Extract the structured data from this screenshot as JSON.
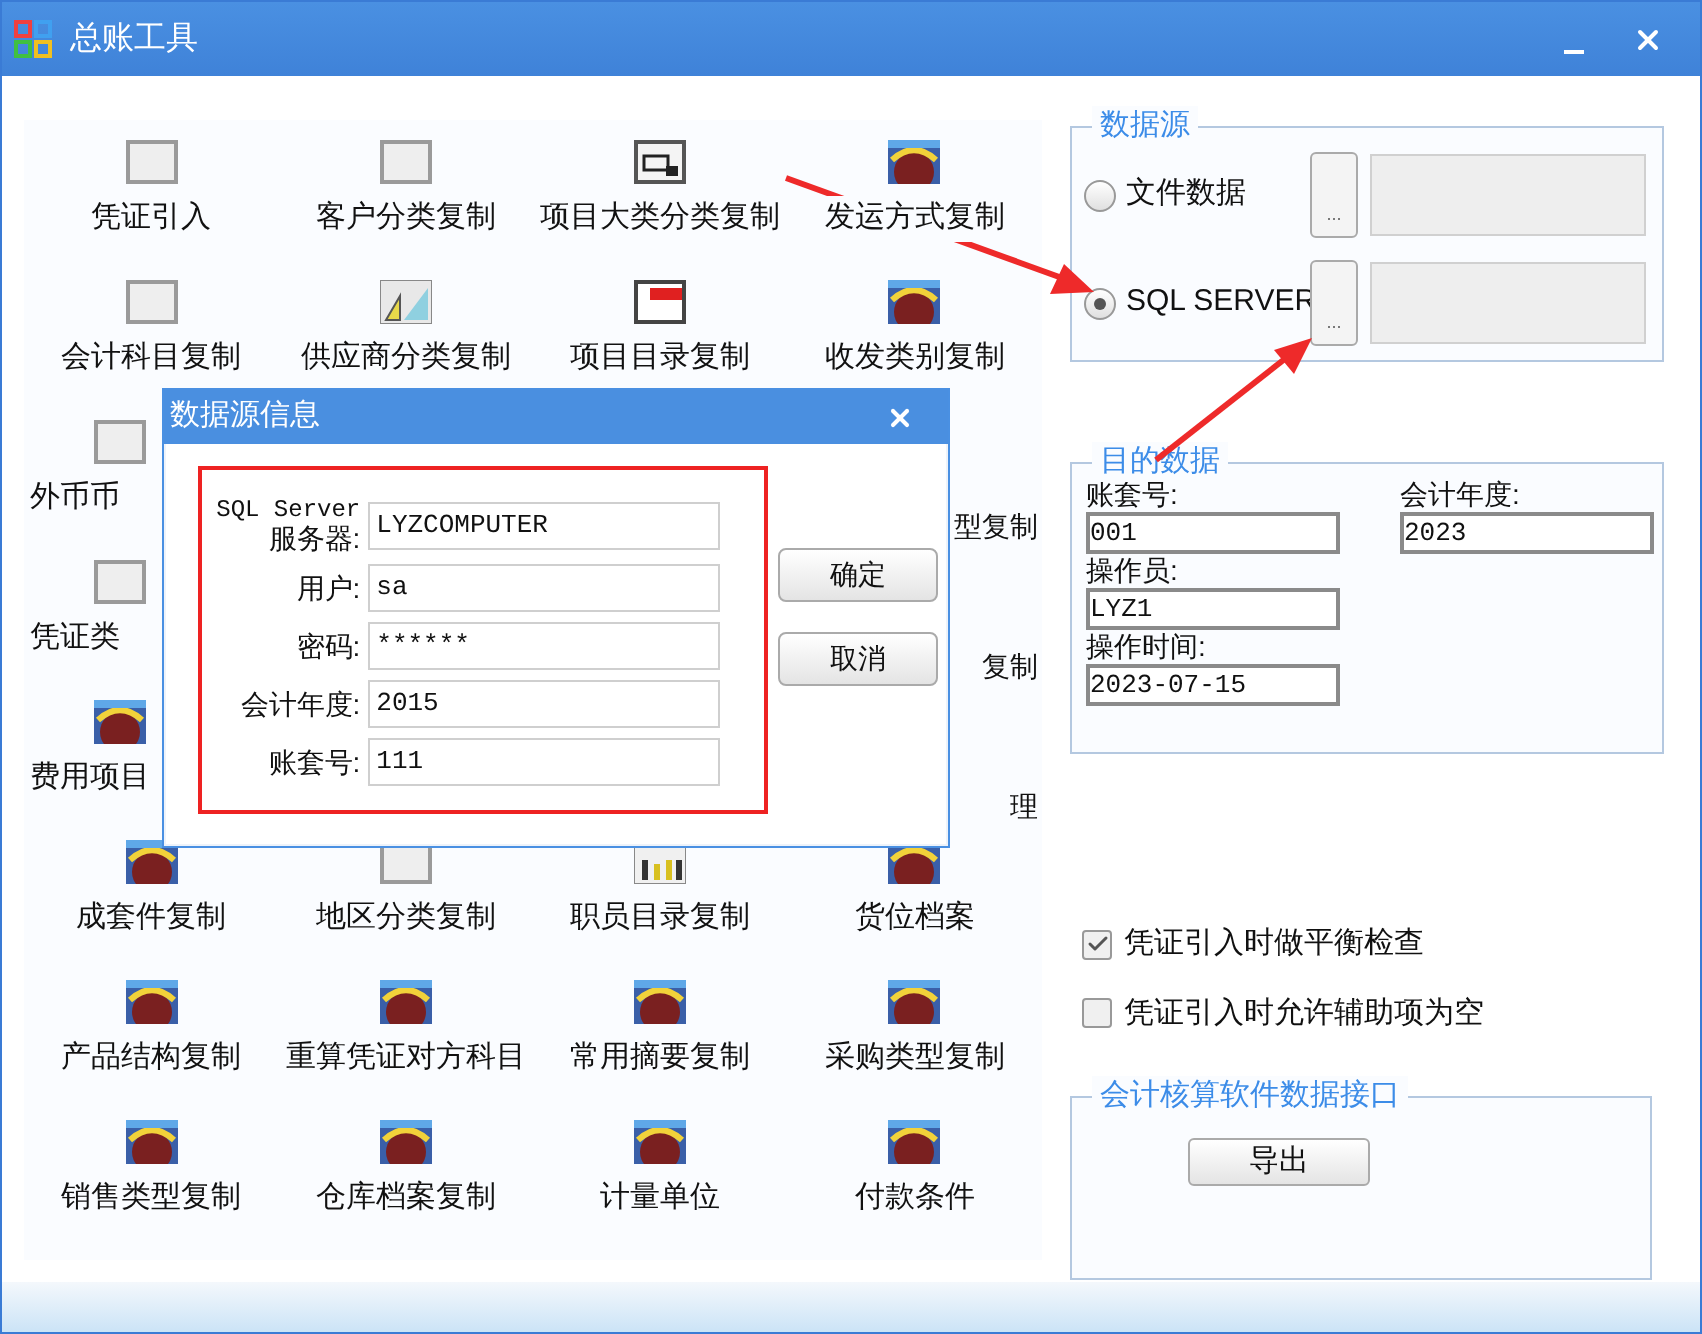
{
  "window": {
    "title": "总账工具"
  },
  "tools": [
    [
      {
        "label": "凭证引入",
        "kind": "blank"
      },
      {
        "label": "客户分类复制",
        "kind": "blank"
      },
      {
        "label": "项目大类分类复制",
        "kind": "form"
      },
      {
        "label": "发运方式复制",
        "kind": "photo"
      }
    ],
    [
      {
        "label": "会计科目复制",
        "kind": "blank"
      },
      {
        "label": "供应商分类复制",
        "kind": "arrows"
      },
      {
        "label": "项目目录复制",
        "kind": "menu"
      },
      {
        "label": "收发类别复制",
        "kind": "photo"
      }
    ],
    {
      "left": {
        "label": "外币币",
        "kind": "blank"
      },
      "right": {
        "label": "型复制"
      }
    },
    {
      "left": {
        "label": "凭证类",
        "kind": "blank"
      },
      "right": {
        "label": "复制"
      }
    },
    {
      "left": {
        "label": "费用项目",
        "kind": "photo"
      },
      "right": {
        "label": "理"
      }
    },
    [
      {
        "label": "成套件复制",
        "kind": "photo"
      },
      {
        "label": "地区分类复制",
        "kind": "blank"
      },
      {
        "label": "职员目录复制",
        "kind": "chart"
      },
      {
        "label": "货位档案",
        "kind": "photo"
      }
    ],
    [
      {
        "label": "产品结构复制",
        "kind": "photo"
      },
      {
        "label": "重算凭证对方科目",
        "kind": "photo"
      },
      {
        "label": "常用摘要复制",
        "kind": "photo"
      },
      {
        "label": "采购类型复制",
        "kind": "photo"
      }
    ],
    [
      {
        "label": "销售类型复制",
        "kind": "photo"
      },
      {
        "label": "仓库档案复制",
        "kind": "photo"
      },
      {
        "label": "计量单位",
        "kind": "photo"
      },
      {
        "label": "付款条件",
        "kind": "photo"
      }
    ]
  ],
  "data_source": {
    "title": "数据源",
    "options": [
      {
        "label": "文件数据",
        "selected": false,
        "browse": "..."
      },
      {
        "label": "SQL SERVER",
        "selected": true,
        "browse": "..."
      }
    ]
  },
  "target": {
    "title": "目的数据",
    "fields": [
      {
        "label": "账套号:",
        "value": "001"
      },
      {
        "label": "会计年度:",
        "value": "2023"
      },
      {
        "label": "操作员:",
        "value": "LYZ1"
      },
      {
        "label": "操作时间:",
        "value": "2023-07-15"
      }
    ]
  },
  "options": [
    {
      "label": "凭证引入时做平衡检查",
      "checked": true
    },
    {
      "label": "凭证引入时允许辅助项为空",
      "checked": false
    }
  ],
  "interface": {
    "title": "会计核算软件数据接口",
    "button": "导出"
  },
  "dialog": {
    "title": "数据源信息",
    "fields": [
      {
        "label": "SQL Server",
        "label2": "服务器:",
        "value": "LYZCOMPUTER"
      },
      {
        "label": "用户:",
        "value": "sa"
      },
      {
        "label": "密码:",
        "value": "******"
      },
      {
        "label": "会计年度:",
        "value": "2015"
      },
      {
        "label": "账套号:",
        "value": "111"
      }
    ],
    "buttons": [
      "确定",
      "取消"
    ]
  }
}
